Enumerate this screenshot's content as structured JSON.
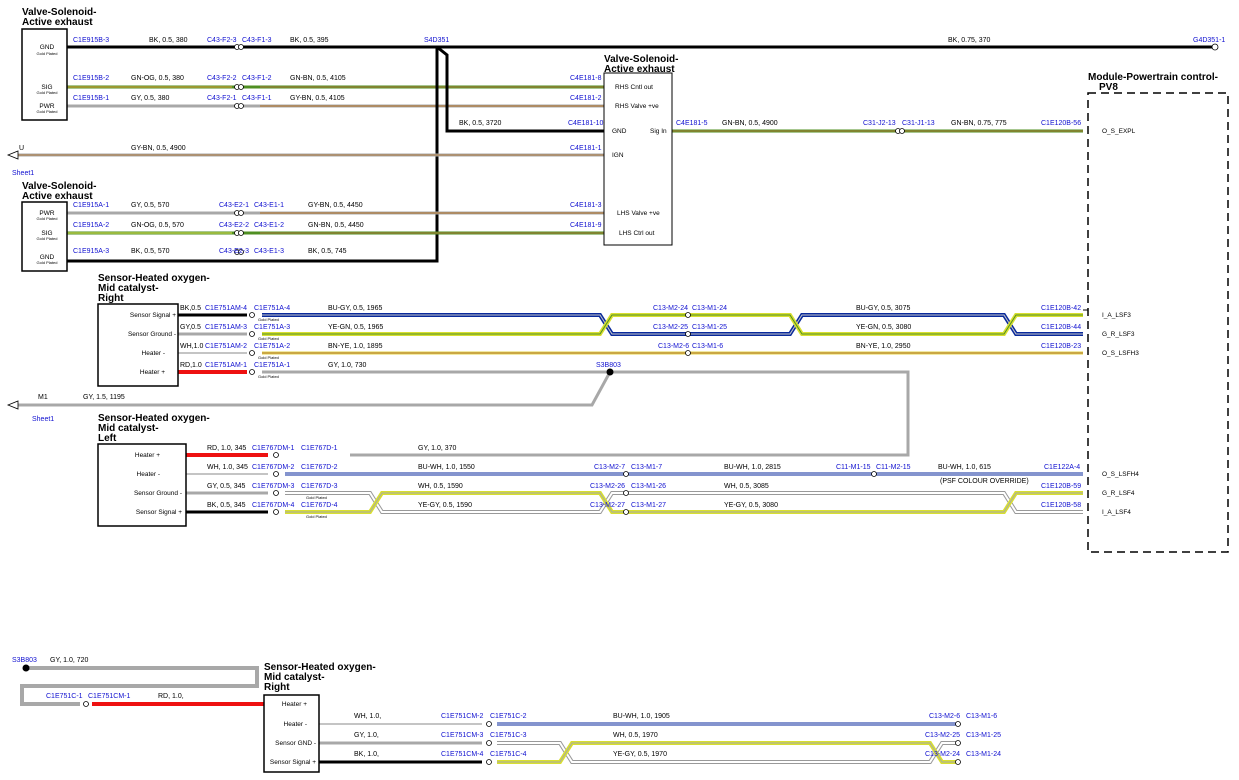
{
  "components": {
    "valve_top": {
      "title1": "Valve-Solenoid-",
      "title2": "Active exhaust",
      "pins": [
        "GND",
        "SIG",
        "PWR"
      ],
      "pin_note": "Gold Plated"
    },
    "valve_mid": {
      "title1": "Valve-Solenoid-",
      "title2": "Active exhaust",
      "pins": [
        "PWR",
        "SIG",
        "GND"
      ],
      "pin_note": "Gold Plated"
    },
    "valve_center": {
      "title1": "Valve-Solenoid-",
      "title2": "Active exhaust",
      "pins": [
        "RHS Cntl out",
        "RHS Valve +ve",
        "GND",
        "IGN",
        "LHS Valve +ve",
        "LHS Ctrl out"
      ],
      "sig_pin": "Sig In"
    },
    "module": {
      "title1": "Module-Powertrain control-",
      "title2": "PV8",
      "pins": [
        "O_S_EXPL",
        "I_A_LSF3",
        "G_R_LSF3",
        "O_S_LSFH3",
        "O_S_LSFH4",
        "G_R_LSF4",
        "I_A_LSF4"
      ]
    },
    "sensor_right": {
      "title1": "Sensor-Heated oxygen-",
      "title2": "Mid catalyst-",
      "title3": "Right",
      "pins": [
        "Sensor Signal +",
        "Sensor Ground -",
        "Heater -",
        "Heater +"
      ]
    },
    "sensor_left": {
      "title1": "Sensor-Heated oxygen-",
      "title2": "Mid catalyst-",
      "title3": "Left",
      "pins": [
        "Heater +",
        "Heater -",
        "Sensor Ground -",
        "Sensor Signal +"
      ]
    },
    "sensor_bottom": {
      "title1": "Sensor-Heated oxygen-",
      "title2": "Mid catalyst-",
      "title3": "Right",
      "pins": [
        "Heater +",
        "Heater -",
        "Sensor GND -",
        "Sensor Signal +"
      ]
    }
  },
  "wires": [
    {
      "conn": [
        "C1E915B-3",
        "C43-F2-3",
        "C43-F1-3",
        "S4D351",
        "G4D351-1"
      ],
      "spec": [
        "BK, 0.5, 380",
        "BK, 0.5, 395",
        "BK, 0.75, 370"
      ]
    },
    {
      "conn": [
        "C1E915B-2",
        "C43-F2-2",
        "C43-F1-2",
        "C4E181-8"
      ],
      "spec": [
        "GN-OG, 0.5, 380",
        "GN-BN, 0.5, 4105"
      ]
    },
    {
      "conn": [
        "C1E915B-1",
        "C43-F2-1",
        "C43-F1-1",
        "C4E181-2"
      ],
      "spec": [
        "GY, 0.5, 380",
        "GY-BN, 0.5, 4105"
      ]
    },
    {
      "conn": [
        "C4E181-10"
      ],
      "spec": [
        "BK, 0.5, 3720"
      ]
    },
    {
      "conn": [
        "C4E181-5",
        "C31-J2-13",
        "C31-J1-13",
        "C1E120B-56"
      ],
      "spec": [
        "GN-BN, 0.5, 4900",
        "GN-BN, 0.75, 775"
      ]
    },
    {
      "conn": [
        "C4E181-1"
      ],
      "spec": [
        "GY-BN, 0.5, 4900"
      ],
      "offpage": "U",
      "sheet": "Sheet1"
    },
    {
      "conn": [
        "C1E915A-1",
        "C43-E2-1",
        "C43-E1-1",
        "C4E181-3"
      ],
      "spec": [
        "GY, 0.5, 570",
        "GY-BN, 0.5, 4450"
      ]
    },
    {
      "conn": [
        "C1E915A-2",
        "C43-E2-2",
        "C43-E1-2",
        "C4E181-9"
      ],
      "spec": [
        "GN-OG, 0.5, 570",
        "GN-BN, 0.5, 4450"
      ]
    },
    {
      "conn": [
        "C1E915A-3",
        "C43-E2-3",
        "C43-E1-3"
      ],
      "spec": [
        "BK, 0.5, 570",
        "BK, 0.5, 745"
      ]
    },
    {
      "conn": [
        "C1E751AM-4",
        "C1E751A-4",
        "C13-M2-24",
        "C13-M1-24",
        "C1E120B-42"
      ],
      "spec": [
        "BK,0.5",
        "BU-GY, 0.5, 1965",
        "BU-GY, 0.5, 3075"
      ]
    },
    {
      "conn": [
        "C1E751AM-3",
        "C1E751A-3",
        "C13-M2-25",
        "C13-M1-25",
        "C1E120B-44"
      ],
      "spec": [
        "GY,0.5",
        "YE-GN, 0.5, 1965",
        "YE-GN, 0.5, 3080"
      ]
    },
    {
      "conn": [
        "C1E751AM-2",
        "C1E751A-2",
        "C13-M2-6",
        "C13-M1-6",
        "C1E120B-23"
      ],
      "spec": [
        "WH,1.0",
        "BN-YE, 1.0, 1895",
        "BN-YE, 1.0, 2950"
      ]
    },
    {
      "conn": [
        "C1E751AM-1",
        "C1E751A-1",
        "S3B803"
      ],
      "spec": [
        "RD,1.0",
        "GY, 1.0, 730"
      ]
    },
    {
      "conn": [],
      "spec": [
        "GY, 1.5, 1195"
      ],
      "offpage": "M1",
      "sheet": "Sheet1"
    },
    {
      "conn": [
        "C1E767DM-1",
        "C1E767D-1"
      ],
      "spec": [
        "RD, 1.0, 345",
        "GY, 1.0, 370"
      ]
    },
    {
      "conn": [
        "C1E767DM-2",
        "C1E767D-2",
        "C13-M2-7",
        "C13-M1-7",
        "C11-M1-15",
        "C11-M2-15",
        "C1E122A-4"
      ],
      "spec": [
        "WH, 1.0, 345",
        "BU-WH, 1.0, 1550",
        "BU-WH, 1.0, 2815",
        "BU-WH, 1.0, 615"
      ],
      "note": "(PSF COLOUR OVERRIDE)"
    },
    {
      "conn": [
        "C1E767DM-3",
        "C1E767D-3",
        "C13-M2-26",
        "C13-M1-26",
        "C1E120B-59"
      ],
      "spec": [
        "GY, 0.5, 345",
        "WH, 0.5, 1590",
        "WH, 0.5, 3085"
      ]
    },
    {
      "conn": [
        "C1E767DM-4",
        "C1E767D-4",
        "C13-M2-27",
        "C13-M1-27",
        "C1E120B-58"
      ],
      "spec": [
        "BK, 0.5, 345",
        "YE-GY, 0.5, 1590",
        "YE-GY, 0.5, 3080"
      ]
    },
    {
      "conn": [
        "S3B803"
      ],
      "spec": [
        "GY, 1.0, 720"
      ]
    },
    {
      "conn": [
        "C1E751C-1",
        "C1E751CM-1"
      ],
      "spec": [
        "RD, 1.0,"
      ]
    },
    {
      "conn": [
        "C1E751CM-2",
        "C1E751C-2",
        "C13-M2-6",
        "C13-M1-6"
      ],
      "spec": [
        "WH, 1.0,",
        "BU-WH, 1.0, 1905"
      ]
    },
    {
      "conn": [
        "C1E751CM-3",
        "C1E751C-3",
        "C13-M2-25",
        "C13-M1-25"
      ],
      "spec": [
        "GY, 1.0,",
        "WH, 0.5, 1970"
      ]
    },
    {
      "conn": [
        "C1E751CM-4",
        "C1E751C-4",
        "C13-M2-24",
        "C13-M1-24"
      ],
      "spec": [
        "BK, 1.0,",
        "YE-GY, 0.5, 1970"
      ]
    }
  ],
  "labels": {
    "gold": "Gold Plated"
  },
  "colors": {
    "BK": "#000000",
    "GY": "#a8a8a8",
    "GN": "#5aa02c",
    "BN": "#b07a3c",
    "BU": "#0a2a9c",
    "YE": "#e6e65a",
    "RD": "#ee1111",
    "WH": "#ffffff",
    "conn": "#1010d0"
  }
}
